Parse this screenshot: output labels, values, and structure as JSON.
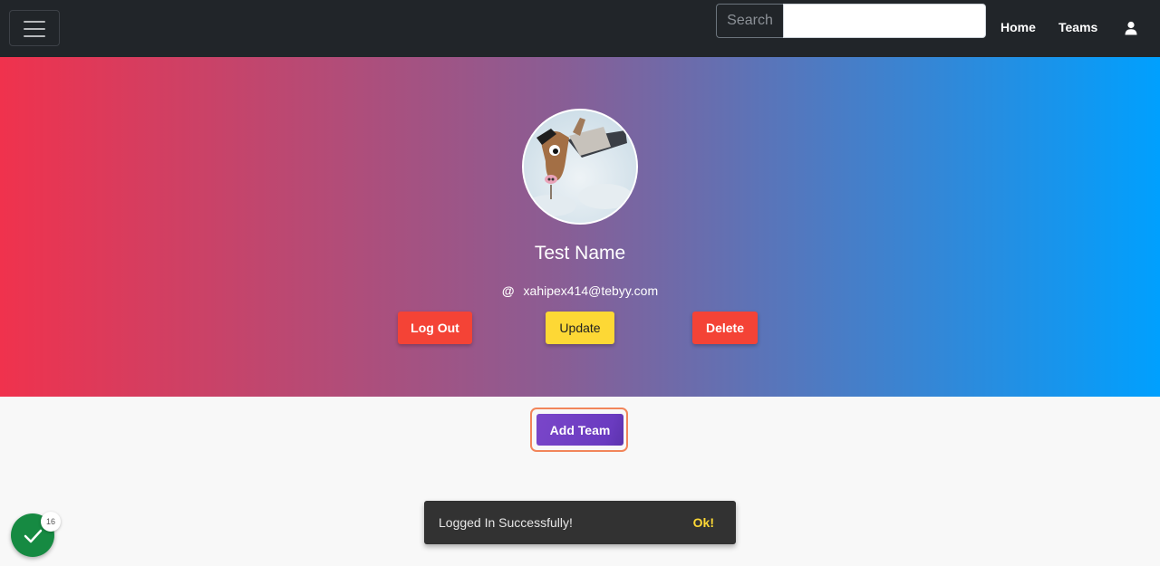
{
  "navbar": {
    "search_label": "Search",
    "search_value": "",
    "links": [
      {
        "label": "Home"
      },
      {
        "label": "Teams"
      }
    ],
    "menu_icon": "hamburger-icon",
    "user_icon": "user-icon"
  },
  "profile": {
    "name": "Test Name",
    "email": "xahipex414@tebyy.com",
    "email_icon": "@",
    "avatar_icon": "avatar-image",
    "gradient": [
      "#f0324d",
      "#8a5d94",
      "#00a0fe"
    ]
  },
  "actions": {
    "logout_label": "Log Out",
    "update_label": "Update",
    "delete_label": "Delete",
    "add_team_label": "Add Team"
  },
  "toast": {
    "message": "Logged In Successfully!",
    "action": "Ok!"
  },
  "fab": {
    "badge": "16",
    "icon": "check-icon",
    "color": "#168a42"
  }
}
